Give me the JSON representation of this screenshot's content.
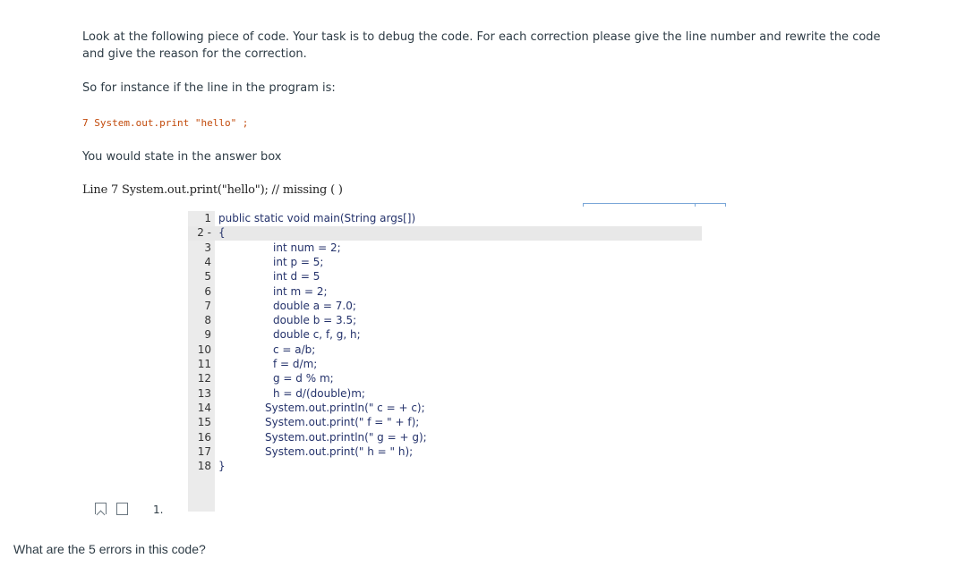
{
  "intro": "Look at the following piece of code. Your task is to debug the code. For each correction please give the line number and rewrite the code and give the reason for the correction.",
  "instance": "So for instance if the line in the program is:",
  "example": "7 System.out.print \"hello\" ;",
  "state": "You would state in the answer box",
  "line7": "Line 7 System.out.print(\"hello\"); // missing ( )",
  "code": {
    "lines": [
      {
        "n": "1",
        "text": "public static void main(String args[])"
      },
      {
        "n": "2 -",
        "text": "{"
      },
      {
        "n": "3",
        "text": "int num = 2;"
      },
      {
        "n": "4",
        "text": "int p = 5;"
      },
      {
        "n": "5",
        "text": "int d = 5"
      },
      {
        "n": "6",
        "text": "int m = 2;"
      },
      {
        "n": "7",
        "text": "double a = 7.0;"
      },
      {
        "n": "8",
        "text": "double b = 3.5;"
      },
      {
        "n": "9",
        "text": "double c, f, g, h;"
      },
      {
        "n": "10",
        "text": "c = a/b;"
      },
      {
        "n": "11",
        "text": "f = d/m;"
      },
      {
        "n": "12",
        "text": "g = d % m;"
      },
      {
        "n": "13",
        "text": "h = d/(double)m;"
      },
      {
        "n": "14",
        "text": "System.out.println(\" c = + c);"
      },
      {
        "n": "15",
        "text": "System.out.print(\" f = \" + f);"
      },
      {
        "n": "16",
        "text": "System.out.println(\" g = + g);"
      },
      {
        "n": "17",
        "text": "System.out.print(\" h = \" h);"
      },
      {
        "n": "18",
        "text": "}"
      }
    ]
  },
  "question_number": "1.",
  "question": "What are the 5 errors in this code?"
}
